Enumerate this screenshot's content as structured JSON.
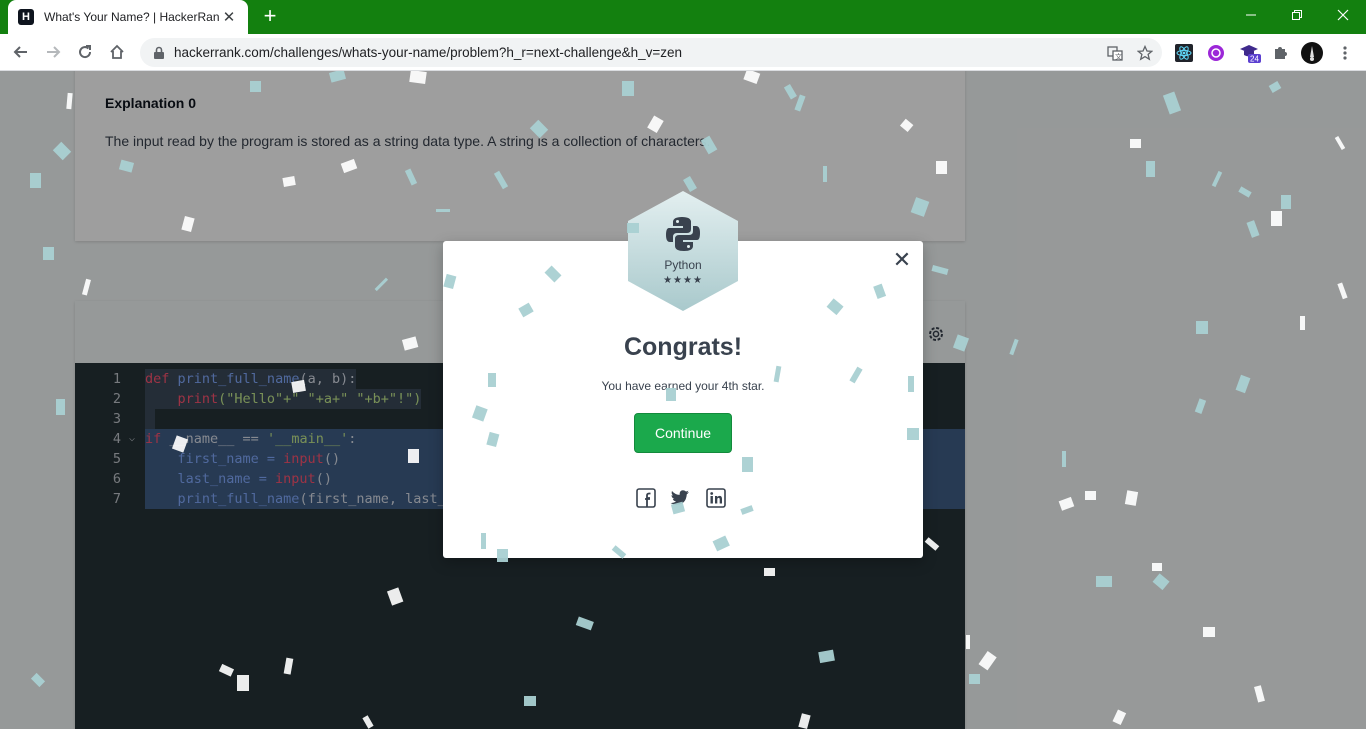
{
  "browser": {
    "tab_title": "What's Your Name? | HackerRank",
    "url": "hackerrank.com/challenges/whats-your-name/problem?h_r=next-challenge&h_v=zen",
    "extension_badge": "24"
  },
  "page": {
    "explanation_title": "Explanation 0",
    "explanation_text": "The input read by the program is stored as a string data type. A string is a collection of characters.",
    "code_lines": [
      {
        "num": "1",
        "fold": ""
      },
      {
        "num": "2",
        "fold": ""
      },
      {
        "num": "3",
        "fold": ""
      },
      {
        "num": "4",
        "fold": "⌵"
      },
      {
        "num": "5",
        "fold": ""
      },
      {
        "num": "6",
        "fold": ""
      },
      {
        "num": "7",
        "fold": ""
      }
    ],
    "code": {
      "l1_def": "def",
      "l1_fn": "print_full_name",
      "l1_args": "(a, b):",
      "l2_indent": "    ",
      "l2_fn": "print",
      "l2_rest": "(\"Hello\"+\" \"+a+\" \"+b+\"!\")",
      "l4_if": "if",
      "l4_rest": " __name__ == ",
      "l4_str": "'__main__'",
      "l4_colon": ":",
      "l5_var": "    first_name = ",
      "l5_fn": "input",
      "l5_paren": "()",
      "l6_var": "    last_name = ",
      "l6_fn": "input",
      "l6_paren": "()",
      "l7_fn": "    print_full_name",
      "l7_rest": "(first_name, last_name)"
    }
  },
  "modal": {
    "badge_language": "Python",
    "badge_stars": "★★★★",
    "title": "Congrats!",
    "subtitle": "You have earned your 4th star.",
    "continue_label": "Continue",
    "close_symbol": "✕"
  },
  "colors": {
    "accent_green": "#1ba94c",
    "titlebar_green": "#13800f"
  }
}
